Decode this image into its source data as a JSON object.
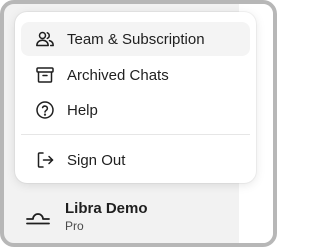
{
  "menu": {
    "items": [
      {
        "label": "Team & Subscription",
        "icon": "team-icon"
      },
      {
        "label": "Archived Chats",
        "icon": "archive-icon"
      },
      {
        "label": "Help",
        "icon": "help-icon"
      },
      {
        "label": "Sign Out",
        "icon": "sign-out-icon"
      }
    ]
  },
  "account": {
    "name": "Libra Demo",
    "plan": "Pro",
    "logo_icon": "libra-logo-icon"
  },
  "colors": {
    "text": "#1f1f1f",
    "frame_border": "#b7b7b7",
    "background": "#f2f2f2",
    "menu_background": "#ffffff",
    "hover": "#f4f4f4"
  }
}
